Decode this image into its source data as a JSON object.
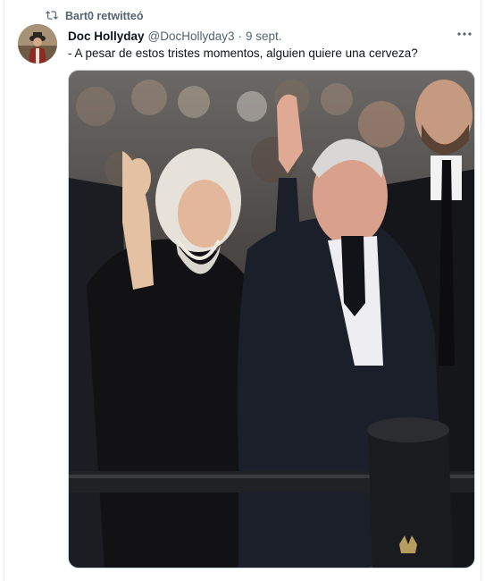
{
  "retweet": {
    "label": "Bart0 retwitteó",
    "icon": "retweet-icon"
  },
  "tweet": {
    "author_name": "Doc Hollyday",
    "author_handle": "@DocHollyday3",
    "separator": "·",
    "date": "9 sept.",
    "text": "- A pesar de estos tristes momentos, alguien quiere una cerveza?",
    "more_icon": "more-icon"
  },
  "colors": {
    "secondary_text": "#536471",
    "primary_text": "#0f1419",
    "border": "#e6ecf0"
  }
}
